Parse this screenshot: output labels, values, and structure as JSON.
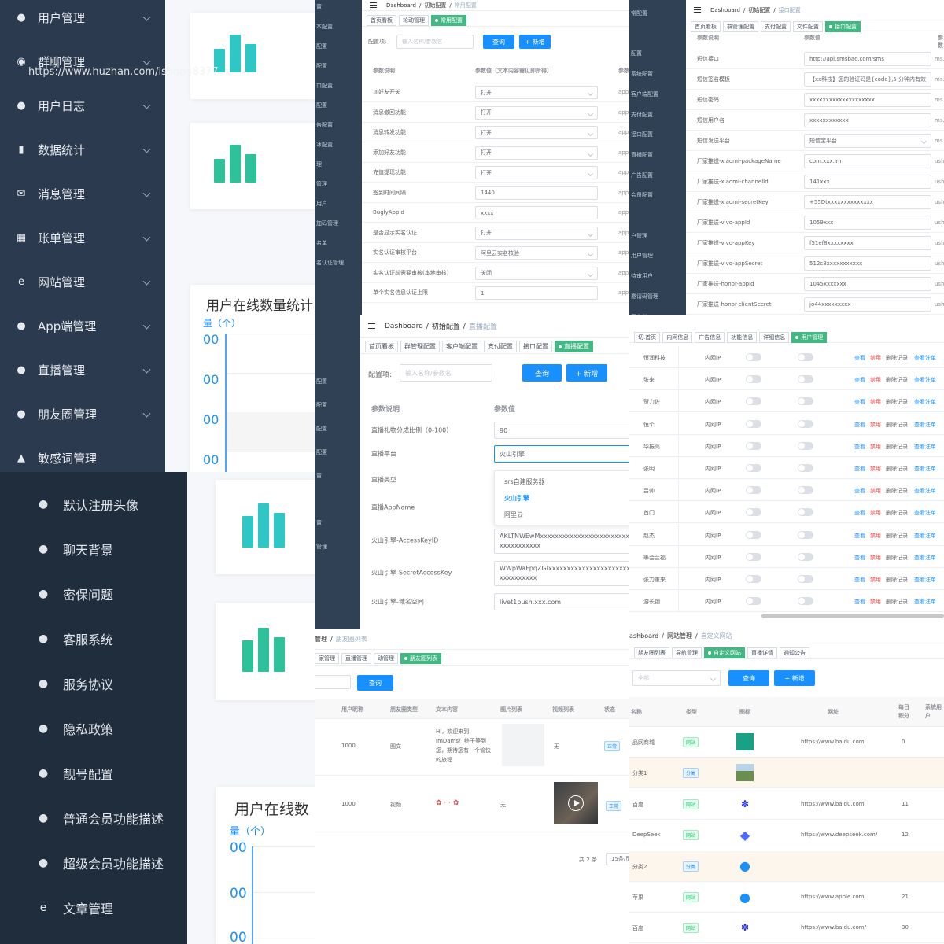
{
  "sidebar_top": {
    "items": [
      {
        "label": "用户管理",
        "icon": "user-icon"
      },
      {
        "label": "群聊管理",
        "icon": "chat-icon"
      },
      {
        "label": "用户日志",
        "icon": "user-log-icon"
      },
      {
        "label": "数据统计",
        "icon": "bar-chart-icon"
      },
      {
        "label": "消息管理",
        "icon": "mail-icon"
      },
      {
        "label": "账单管理",
        "icon": "bill-icon"
      },
      {
        "label": "网站管理",
        "icon": "ie-icon"
      },
      {
        "label": "App端管理",
        "icon": "user-icon"
      },
      {
        "label": "直播管理",
        "icon": "user-icon"
      },
      {
        "label": "朋友圈管理",
        "icon": "user-icon"
      },
      {
        "label": "敏感词管理",
        "icon": "warning-icon"
      }
    ]
  },
  "watermark": "https://www.huzhan.com/ishop48377",
  "sidebar_bottom": {
    "items": [
      {
        "label": "默认注册头像"
      },
      {
        "label": "聊天背景"
      },
      {
        "label": "密保问题"
      },
      {
        "label": "客服系统"
      },
      {
        "label": "服务协议"
      },
      {
        "label": "隐私政策"
      },
      {
        "label": "靓号配置"
      },
      {
        "label": "普通会员功能描述"
      },
      {
        "label": "超级会员功能描述"
      },
      {
        "label": "文章管理",
        "icon": "ie-icon"
      }
    ]
  },
  "chart_top": {
    "title": "用户在线数量统计",
    "unit": "量（个）",
    "yticks": [
      "00",
      "00",
      "00",
      "00"
    ]
  },
  "chart_bottom": {
    "title": "用户在线数",
    "unit": "量（个）",
    "yticks": [
      "00",
      "00",
      "00"
    ]
  },
  "colors": {
    "sidebar": "#2b3a4e",
    "accent": "#1890ff",
    "tag_active": "#42b983",
    "bar_a": "#2fc6c6",
    "bar_b": "#2fc19a"
  },
  "panel_a": {
    "crumbs": [
      "Dashboard",
      "初始配置",
      "常用配置"
    ],
    "tags": [
      "首页看板",
      "轮动管理",
      "常用配置"
    ],
    "search_label": "配置项:",
    "search_placeholder": "输入名称/参数名",
    "query": "查询",
    "add": "+ 新增",
    "col_desc": "参数说明",
    "col_val": "参数值（文本内容需见即所得）",
    "col_more": "参数",
    "rows": [
      {
        "k": "加好友开关",
        "v": "打开",
        "sel": true,
        "x": "app"
      },
      {
        "k": "消息撤回功能",
        "v": "打开",
        "sel": true,
        "x": "app"
      },
      {
        "k": "消息转发功能",
        "v": "打开",
        "sel": true,
        "x": "app"
      },
      {
        "k": "添加好友功能",
        "v": "打开",
        "sel": true,
        "x": "app"
      },
      {
        "k": "充值提现功能",
        "v": "打开",
        "sel": true,
        "x": "app"
      },
      {
        "k": "签到时间间隔",
        "v": "1440",
        "sel": false,
        "x": "app"
      },
      {
        "k": "BuglyAppId",
        "v": "xxxx",
        "sel": false,
        "x": "app"
      },
      {
        "k": "是否显示实名认证",
        "v": "打开",
        "sel": true,
        "x": "app"
      },
      {
        "k": "实名认证审核平台",
        "v": "阿里云实名核验",
        "sel": true,
        "x": "app"
      },
      {
        "k": "实名认证前需要审核(本地审核)",
        "v": "关闭",
        "sel": true,
        "x": "app"
      },
      {
        "k": "单个实名信息认证上限",
        "v": "1",
        "sel": false,
        "x": "app"
      }
    ],
    "side": [
      "置",
      "本配置",
      "配置",
      "配置",
      "口配置",
      "配置",
      "告配置",
      "冰配置",
      "理",
      "管理",
      "用户",
      "加码管理",
      "名单",
      "名认证管理"
    ]
  },
  "panel_b": {
    "crumbs": [
      "Dashboard",
      "初始配置",
      "接口配置"
    ],
    "tags": [
      "首页看板",
      "群管理配置",
      "支付配置",
      "文件配置",
      "接口配置"
    ],
    "col_desc": "参数说明",
    "col_val": "参数值",
    "col_more": "参数",
    "rows": [
      {
        "k": "短信接口",
        "v": "http://api.smsbao.com/sms",
        "sel": false,
        "x": "ms."
      },
      {
        "k": "短信签名模板",
        "v": "【xx科技】您的验证码是{code},5 分钟内有效",
        "sel": false,
        "x": "ms."
      },
      {
        "k": "短信密码",
        "v": "xxxxxxxxxxxxxxxxxxxx",
        "sel": false,
        "x": "ms."
      },
      {
        "k": "短信用户名",
        "v": "xxxxxxxxxxxx",
        "sel": false,
        "x": "ms."
      },
      {
        "k": "短信发送平台",
        "v": "短信宝平台",
        "sel": true,
        "x": "ms."
      },
      {
        "k": "厂家推送-xiaomi-packageName",
        "v": "com.xxx.im",
        "sel": false,
        "x": "ush"
      },
      {
        "k": "厂家推送-xiaomi-channelId",
        "v": "141xxx",
        "sel": false,
        "x": "ush"
      },
      {
        "k": "厂家推送-xiaomi-secretKey",
        "v": "+55Dtxxxxxxxxxxxxxx",
        "sel": false,
        "x": "ush"
      },
      {
        "k": "厂家推送-vivo-appId",
        "v": "1059xxx",
        "sel": false,
        "x": "ush"
      },
      {
        "k": "厂家推送-vivo-appKey",
        "v": "f51ef8xxxxxxxx",
        "sel": false,
        "x": "ush"
      },
      {
        "k": "厂家推送-vivo-appSecret",
        "v": "512c8xxxxxxxxxxx",
        "sel": false,
        "x": "ush"
      },
      {
        "k": "厂家推送-honor-appId",
        "v": "1045xxxxxxx",
        "sel": false,
        "x": "ush"
      },
      {
        "k": "厂家推送-honor-clientSecret",
        "v": "jo44xxxxxxxxx",
        "sel": false,
        "x": "ush"
      }
    ],
    "side": [
      "常配置",
      "",
      "配置",
      "系统配置",
      "客户端配置",
      "支付配置",
      "接口配置",
      "直播配置",
      "广告配置",
      "会员配置",
      "",
      "户管理",
      "用户管理",
      "待审用户",
      "邀请码管理",
      "黑名单",
      "实名认证管理"
    ]
  },
  "panel_c": {
    "crumbs": [
      "Dashboard",
      "初始配置",
      "直播配置"
    ],
    "tags": [
      "首页看板",
      "群管理配置",
      "客户端配置",
      "支付配置",
      "接口配置",
      "直播配置"
    ],
    "search_label": "配置项:",
    "search_placeholder": "输入名称/参数名",
    "query": "查询",
    "add": "+ 新增",
    "col_desc": "参数说明",
    "col_val": "参数值",
    "rows": [
      {
        "k": "直播礼物分成比例（0-100）",
        "v": "90"
      },
      {
        "k": "直播平台",
        "v": "火山引擎"
      },
      {
        "k": "直播类型",
        "v": ""
      },
      {
        "k": "直播AppName",
        "v": ""
      },
      {
        "k": "火山引擎-AccessKeyID",
        "v": "AKLTNWEwMxxxxxxxxxxxxxxxxxxxxxxxxxxxxxxxxxxxx"
      },
      {
        "k": "火山引擎-SecretAccessKey",
        "v": "WWpWaFpqZGIxxxxxxxxxxxxxxxxxxxxxxxxxxxxxxxxx"
      },
      {
        "k": "火山引擎-域名空间",
        "v": "livet1push.xxx.com"
      }
    ],
    "dropdown": [
      "srs自建服务器",
      "火山引擎",
      "阿里云"
    ],
    "side": [
      "配置",
      "配置",
      "配置",
      "配置",
      "置",
      "",
      "置",
      "管理",
      "",
      "",
      "",
      "理"
    ]
  },
  "panel_d": {
    "tags": [
      "切.首页",
      "内网信息",
      "广告信息",
      "功能信息",
      "详细信息",
      "用户管理"
    ],
    "rows": [
      {
        "name": "恒润科技",
        "ip": "内网IP",
        "a1": "查看",
        "a2": "禁用",
        "a3": "删除记录",
        "a4": "查看注单"
      },
      {
        "name": "张来",
        "ip": "内网IP",
        "a1": "查看",
        "a2": "禁用",
        "a3": "删除记录",
        "a4": "查看注单"
      },
      {
        "name": "贺力佐",
        "ip": "内网IP",
        "a1": "查看",
        "a2": "禁用",
        "a3": "删除记录",
        "a4": "查看注单"
      },
      {
        "name": "恒个",
        "ip": "内网IP",
        "a1": "查看",
        "a2": "禁用",
        "a3": "删除记录",
        "a4": "查看注单"
      },
      {
        "name": "华振高",
        "ip": "内网IP",
        "a1": "查看",
        "a2": "禁用",
        "a3": "删除记录",
        "a4": "查看注单"
      },
      {
        "name": "张明",
        "ip": "内网IP",
        "a1": "查看",
        "a2": "禁用",
        "a3": "删除记录",
        "a4": "查看注单"
      },
      {
        "name": "吕帅",
        "ip": "内网IP",
        "a1": "查看",
        "a2": "禁用",
        "a3": "删除记录",
        "a4": "查看注单"
      },
      {
        "name": "首门",
        "ip": "内网IP",
        "a1": "查看",
        "a2": "禁用",
        "a3": "删除记录",
        "a4": "查看注单"
      },
      {
        "name": "赵杰",
        "ip": "内网IP",
        "a1": "查看",
        "a2": "禁用",
        "a3": "删除记录",
        "a4": "查看注单"
      },
      {
        "name": "等会兰福",
        "ip": "内网IP",
        "a1": "查看",
        "a2": "禁用",
        "a3": "删除记录",
        "a4": "查看注单"
      },
      {
        "name": "张力重来",
        "ip": "内网IP",
        "a1": "查看",
        "a2": "禁用",
        "a3": "删除记录",
        "a4": "查看注单"
      },
      {
        "name": "游长钢",
        "ip": "内网IP",
        "a1": "查看",
        "a2": "禁用",
        "a3": "删除记录",
        "a4": "查看注单"
      }
    ]
  },
  "panel_e": {
    "crumbs": [
      "管理",
      "朋友圈列表"
    ],
    "tags": [
      "家管理",
      "直播管理",
      "动管理",
      "朋友圈列表"
    ],
    "query": "查询",
    "cols": [
      "用户昵称",
      "朋友圈类型",
      "文本内容",
      "图片列表",
      "视频列表",
      "状态"
    ],
    "rows": [
      {
        "nick": "1000",
        "type": "图文",
        "text": "Hi，欢迎来到ImDams！终于等到您，期待您有一个愉快的旅程",
        "video": "无",
        "status": "正常"
      },
      {
        "nick": "1000",
        "type": "视频",
        "text": "",
        "video": "无",
        "status": "正常"
      }
    ],
    "pager": "共 2 条",
    "pagesize": "15条/页"
  },
  "panel_f": {
    "crumbs": [
      "ashboard",
      "网站管理",
      "自定义网站"
    ],
    "tags": [
      "朋友圈列表",
      "导航管理",
      "自定义网站",
      "直播详情",
      "通知公告"
    ],
    "filter": "全部",
    "query": "查询",
    "add": "+ 新增",
    "cols": [
      "名称",
      "类型",
      "图标",
      "网址",
      "每日积分",
      "系统用户"
    ],
    "rows": [
      {
        "name": "品网商城",
        "type": "网站",
        "url": "https://www.baidu.com",
        "pts": "0",
        "cat": false
      },
      {
        "name": "分类1",
        "type": "分类",
        "url": "",
        "pts": "",
        "cat": true
      },
      {
        "name": "百度",
        "type": "网站",
        "url": "https://www.baidu.com",
        "pts": "11",
        "cat": false
      },
      {
        "name": "DeepSeek",
        "type": "网站",
        "url": "https://www.deepseek.com/",
        "pts": "12",
        "cat": false
      },
      {
        "name": "分类2",
        "type": "分类",
        "url": "",
        "pts": "",
        "cat": true
      },
      {
        "name": "苹果",
        "type": "网站",
        "url": "https://www.apple.com",
        "pts": "21",
        "cat": false
      },
      {
        "name": "百度",
        "type": "网站",
        "url": "https://www.baidu.com/",
        "pts": "30",
        "cat": false
      }
    ]
  }
}
